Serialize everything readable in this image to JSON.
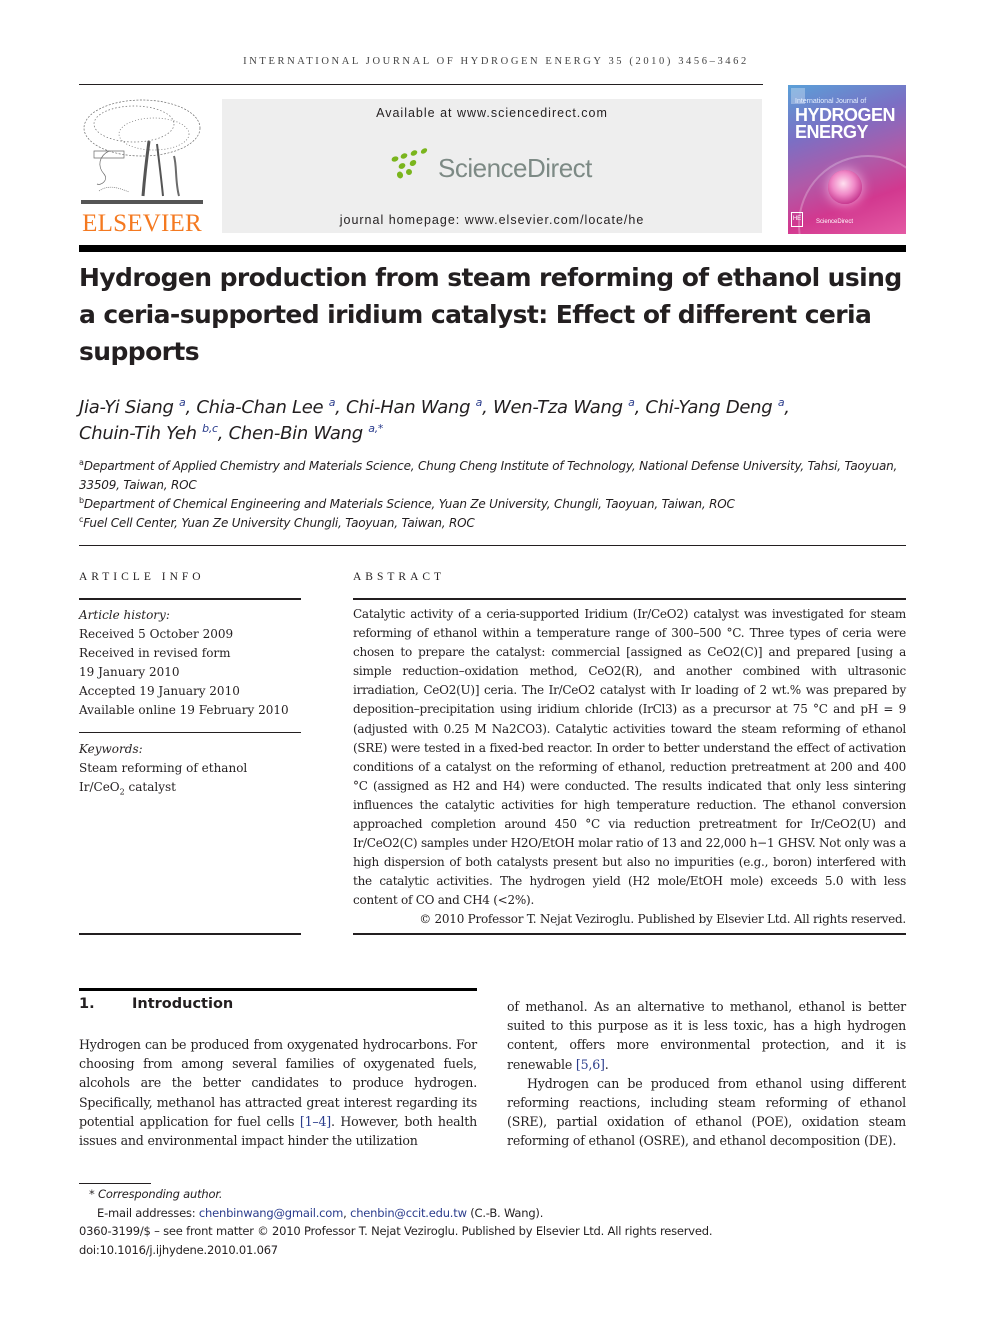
{
  "header": {
    "running_head": "INTERNATIONAL JOURNAL OF HYDROGEN ENERGY 35 (2010) 3456–3462",
    "publisher_logo_text": "ELSEVIER",
    "available_at": "Available at www.sciencedirect.com",
    "sciencedirect_logo_text": "ScienceDirect",
    "journal_homepage": "journal homepage: www.elsevier.com/locate/he",
    "cover": {
      "line1": "International Journal of",
      "line2": "HYDROGEN",
      "line3": "ENERGY",
      "he_badge": "HE",
      "sd_label": "ScienceDirect"
    },
    "colors": {
      "elsevier_orange": "#f47920",
      "sciencedirect_green": "#7ab51d",
      "link_blue": "#2a3c8c"
    }
  },
  "article": {
    "title": "Hydrogen production from steam reforming of ethanol using a ceria-supported iridium catalyst: Effect of different ceria supports",
    "authors": [
      {
        "name": "Jia-Yi Siang",
        "aff": "a"
      },
      {
        "name": "Chia-Chan Lee",
        "aff": "a"
      },
      {
        "name": "Chi-Han Wang",
        "aff": "a"
      },
      {
        "name": "Wen-Tza Wang",
        "aff": "a"
      },
      {
        "name": "Chi-Yang Deng",
        "aff": "a"
      },
      {
        "name": "Chuin-Tih Yeh",
        "aff": "b,c"
      },
      {
        "name": "Chen-Bin Wang",
        "aff": "a,*"
      }
    ],
    "affiliations": [
      {
        "key": "a",
        "text": "Department of Applied Chemistry and Materials Science, Chung Cheng Institute of Technology, National Defense University, Tahsi, Taoyuan, 33509, Taiwan, ROC"
      },
      {
        "key": "b",
        "text": "Department of Chemical Engineering and Materials Science, Yuan Ze University, Chungli, Taoyuan, Taiwan, ROC"
      },
      {
        "key": "c",
        "text": "Fuel Cell Center, Yuan Ze University Chungli, Taoyuan, Taiwan, ROC"
      }
    ]
  },
  "article_info": {
    "heading": "ARTICLE INFO",
    "history_label": "Article history:",
    "history": [
      "Received 5 October 2009",
      "Received in revised form",
      "19 January 2010",
      "Accepted 19 January 2010",
      "Available online 19 February 2010"
    ],
    "keywords_label": "Keywords:",
    "keywords": [
      "Steam reforming of ethanol",
      "Ir/CeO2 catalyst"
    ]
  },
  "abstract": {
    "heading": "ABSTRACT",
    "text": "Catalytic activity of a ceria-supported Iridium (Ir/CeO2) catalyst was investigated for steam reforming of ethanol within a temperature range of 300–500 °C. Three types of ceria were chosen to prepare the catalyst: commercial [assigned as CeO2(C)] and prepared [using a simple reduction–oxidation method, CeO2(R), and another combined with ultrasonic irradiation, CeO2(U)] ceria. The Ir/CeO2 catalyst with Ir loading of 2 wt.% was prepared by deposition–precipitation using iridium chloride (IrCl3) as a precursor at 75 °C and pH = 9 (adjusted with 0.25 M Na2CO3). Catalytic activities toward the steam reforming of ethanol (SRE) were tested in a fixed-bed reactor. In order to better understand the effect of activation conditions of a catalyst on the reforming of ethanol, reduction pretreatment at 200 and 400 °C (assigned as H2 and H4) were conducted. The results indicated that only less sintering influences the catalytic activities for high temperature reduction. The ethanol conversion approached completion around 450 °C via reduction pretreatment for Ir/CeO2(U) and Ir/CeO2(C) samples under H2O/EtOH molar ratio of 13 and 22,000 h−1 GHSV. Not only was a high dispersion of both catalysts present but also no impurities (e.g., boron) interfered with the catalytic activities. The hydrogen yield (H2 mole/EtOH mole) exceeds 5.0 with less content of CO and CH4 (<2%).",
    "copyright": "© 2010 Professor T. Nejat Veziroglu. Published by Elsevier Ltd. All rights reserved."
  },
  "introduction": {
    "number": "1.",
    "heading": "Introduction",
    "left_column": {
      "p1_before_ref": "Hydrogen can be produced from oxygenated hydrocarbons. For choosing from among several families of oxygenated fuels, alcohols are the better candidates to produce hydrogen. Specifically, methanol has attracted great interest regarding its potential application for fuel cells ",
      "p1_ref": "[1–4]",
      "p1_after_ref": ". However, both health issues and environmental impact hinder the utilization"
    },
    "right_column": {
      "p1_before_ref": "of methanol. As an alternative to methanol, ethanol is better suited to this purpose as it is less toxic, has a high hydrogen content, offers more environmental protection, and it is renewable ",
      "p1_ref": "[5,6]",
      "p1_after_ref": ".",
      "p2": "Hydrogen can be produced from ethanol using different reforming reactions, including steam reforming of ethanol (SRE), partial oxidation of ethanol (POE), oxidation steam reforming of ethanol (OSRE), and ethanol decomposition (DE)."
    }
  },
  "footnotes": {
    "corresponding_mark": "*",
    "corresponding_label": "Corresponding author.",
    "email_label": "E-mail addresses: ",
    "email1": "chenbinwang@gmail.com",
    "email_sep": ", ",
    "email2": "chenbin@ccit.edu.tw",
    "email_owner": " (C.-B. Wang).",
    "front_matter": "0360-3199/$ – see front matter © 2010 Professor T. Nejat Veziroglu. Published by Elsevier Ltd. All rights reserved.",
    "doi": "doi:10.1016/j.ijhydene.2010.01.067"
  }
}
